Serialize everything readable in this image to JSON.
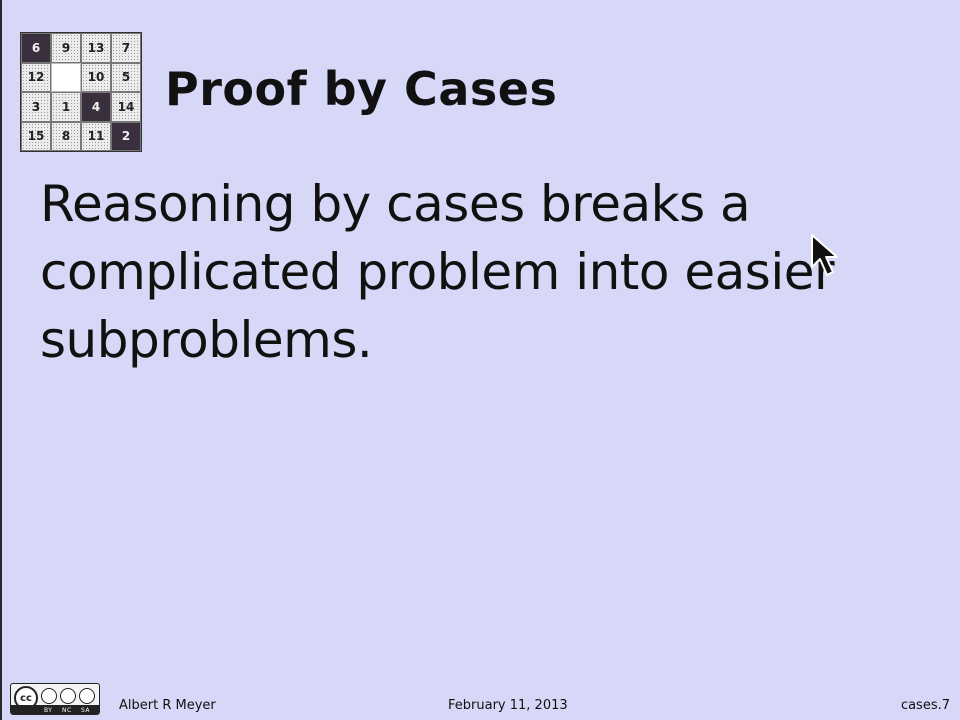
{
  "slide": {
    "title": "Proof by Cases",
    "body": "Reasoning by cases breaks a complicated problem into easier subproblems."
  },
  "puzzle": {
    "tiles": [
      {
        "label": "6",
        "style": "dark"
      },
      {
        "label": "9",
        "style": "light"
      },
      {
        "label": "13",
        "style": "light"
      },
      {
        "label": "7",
        "style": "light"
      },
      {
        "label": "12",
        "style": "light"
      },
      {
        "label": "",
        "style": "blank"
      },
      {
        "label": "10",
        "style": "light"
      },
      {
        "label": "5",
        "style": "light"
      },
      {
        "label": "3",
        "style": "light"
      },
      {
        "label": "1",
        "style": "light"
      },
      {
        "label": "4",
        "style": "dark"
      },
      {
        "label": "14",
        "style": "light"
      },
      {
        "label": "15",
        "style": "light"
      },
      {
        "label": "8",
        "style": "light"
      },
      {
        "label": "11",
        "style": "light"
      },
      {
        "label": "2",
        "style": "dark"
      }
    ]
  },
  "footer": {
    "license_icon": "creative-commons-by-nc-sa-icon",
    "license_labels": [
      "BY",
      "NC",
      "SA"
    ],
    "author": "Albert R Meyer",
    "date": "February 11, 2013",
    "slide_id": "cases.7"
  },
  "colors": {
    "background": "#d7d7f7",
    "text": "#111111",
    "dark_tile": "#3a2f3f"
  },
  "cursor_icon": "arrow-pointer-icon"
}
